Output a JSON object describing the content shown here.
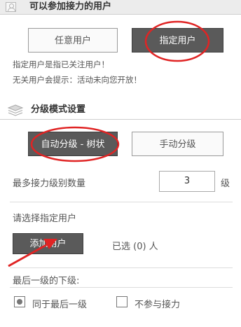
{
  "section1": {
    "title": "可以参加接力的用户",
    "icon": "user-icon",
    "buttons": {
      "any_user": "任意用户",
      "specified_user": "指定用户"
    },
    "hints": [
      "指定用户是指已关注用户！",
      "无关用户会提示：活动未向您开放！"
    ]
  },
  "section2": {
    "title": "分级模式设置",
    "icon": "layers-icon",
    "buttons": {
      "auto_level": "自动分级 - 树状",
      "manual_level": "手动分级"
    },
    "max_levels": {
      "label": "最多接力级别数量",
      "value": "3",
      "unit": "级"
    },
    "select_user": {
      "label": "请选择指定用户",
      "add_button": "添加用户",
      "selected_text": "已选 (0) 人"
    },
    "last_level": {
      "label": "最后一级的下级:",
      "options": [
        {
          "label": "同于最后一级",
          "checked": true
        },
        {
          "label": "不参与接力",
          "checked": false
        }
      ]
    }
  },
  "annotations": {
    "color": "#e02424"
  },
  "colors": {
    "dark_button": "#5a5a5a",
    "header_bg": "#ececec"
  }
}
